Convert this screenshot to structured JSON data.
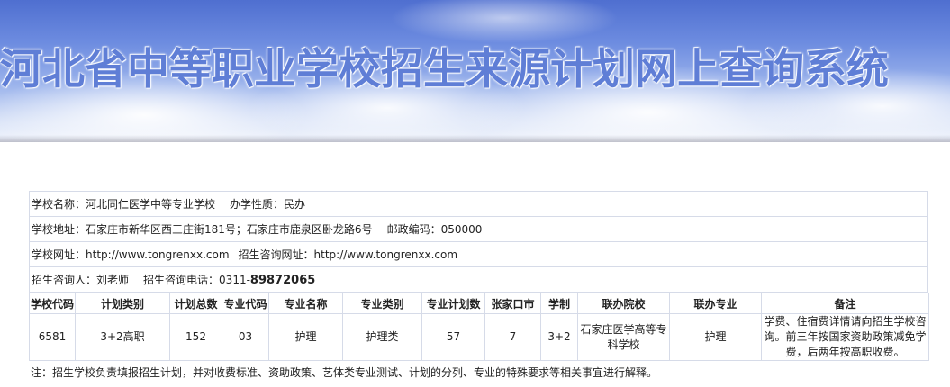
{
  "banner": {
    "title": "河北省中等职业学校招生来源计划网上查询系统"
  },
  "school": {
    "name_label": "学校名称：",
    "name": "河北同仁医学中等专业学校",
    "nature_label": "办学性质：",
    "nature": "民办",
    "address_label": "学校地址：",
    "address": "石家庄市新华区西三庄街181号；石家庄市鹿泉区卧龙路6号",
    "postcode_label": "邮政编码：",
    "postcode": "050000",
    "website_label": "学校网址：",
    "website": "http://www.tongrenxx.com",
    "consult_web_label": "招生咨询网址：",
    "consult_web": "http://www.tongrenxx.com",
    "contact_label": "招生咨询人：",
    "contact": "刘老师",
    "phone_label": "招生咨询电话：",
    "phone_prefix": "0311-",
    "phone_number": "89872065"
  },
  "plan": {
    "headers": [
      "学校代码",
      "计划类别",
      "计划总数",
      "专业代码",
      "专业名称",
      "专业类别",
      "专业计划数",
      "张家口市",
      "学制",
      "联办院校",
      "联办专业",
      "备注"
    ],
    "rows": [
      [
        "6581",
        "3+2高职",
        "152",
        "03",
        "护理",
        "护理类",
        "57",
        "7",
        "3+2",
        "石家庄医学高等专科学校",
        "护理",
        "学费、住宿费详情请向招生学校咨询。前三年按国家资助政策减免学费，后两年按高职收费。"
      ]
    ]
  },
  "note": "注：招生学校负责填报招生计划，并对收费标准、资助政策、艺体类专业测试、计划的分列、专业的特殊要求等相关事宜进行解释。"
}
